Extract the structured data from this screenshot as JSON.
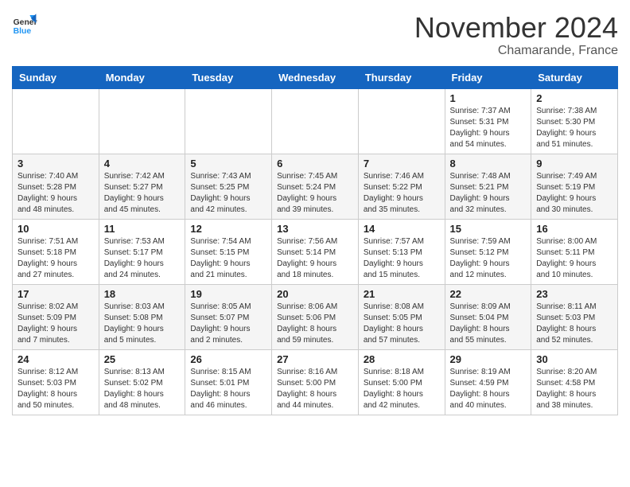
{
  "header": {
    "logo_line1": "General",
    "logo_line2": "Blue",
    "month": "November 2024",
    "location": "Chamarande, France"
  },
  "weekdays": [
    "Sunday",
    "Monday",
    "Tuesday",
    "Wednesday",
    "Thursday",
    "Friday",
    "Saturday"
  ],
  "weeks": [
    [
      {
        "day": "",
        "info": ""
      },
      {
        "day": "",
        "info": ""
      },
      {
        "day": "",
        "info": ""
      },
      {
        "day": "",
        "info": ""
      },
      {
        "day": "",
        "info": ""
      },
      {
        "day": "1",
        "info": "Sunrise: 7:37 AM\nSunset: 5:31 PM\nDaylight: 9 hours\nand 54 minutes."
      },
      {
        "day": "2",
        "info": "Sunrise: 7:38 AM\nSunset: 5:30 PM\nDaylight: 9 hours\nand 51 minutes."
      }
    ],
    [
      {
        "day": "3",
        "info": "Sunrise: 7:40 AM\nSunset: 5:28 PM\nDaylight: 9 hours\nand 48 minutes."
      },
      {
        "day": "4",
        "info": "Sunrise: 7:42 AM\nSunset: 5:27 PM\nDaylight: 9 hours\nand 45 minutes."
      },
      {
        "day": "5",
        "info": "Sunrise: 7:43 AM\nSunset: 5:25 PM\nDaylight: 9 hours\nand 42 minutes."
      },
      {
        "day": "6",
        "info": "Sunrise: 7:45 AM\nSunset: 5:24 PM\nDaylight: 9 hours\nand 39 minutes."
      },
      {
        "day": "7",
        "info": "Sunrise: 7:46 AM\nSunset: 5:22 PM\nDaylight: 9 hours\nand 35 minutes."
      },
      {
        "day": "8",
        "info": "Sunrise: 7:48 AM\nSunset: 5:21 PM\nDaylight: 9 hours\nand 32 minutes."
      },
      {
        "day": "9",
        "info": "Sunrise: 7:49 AM\nSunset: 5:19 PM\nDaylight: 9 hours\nand 30 minutes."
      }
    ],
    [
      {
        "day": "10",
        "info": "Sunrise: 7:51 AM\nSunset: 5:18 PM\nDaylight: 9 hours\nand 27 minutes."
      },
      {
        "day": "11",
        "info": "Sunrise: 7:53 AM\nSunset: 5:17 PM\nDaylight: 9 hours\nand 24 minutes."
      },
      {
        "day": "12",
        "info": "Sunrise: 7:54 AM\nSunset: 5:15 PM\nDaylight: 9 hours\nand 21 minutes."
      },
      {
        "day": "13",
        "info": "Sunrise: 7:56 AM\nSunset: 5:14 PM\nDaylight: 9 hours\nand 18 minutes."
      },
      {
        "day": "14",
        "info": "Sunrise: 7:57 AM\nSunset: 5:13 PM\nDaylight: 9 hours\nand 15 minutes."
      },
      {
        "day": "15",
        "info": "Sunrise: 7:59 AM\nSunset: 5:12 PM\nDaylight: 9 hours\nand 12 minutes."
      },
      {
        "day": "16",
        "info": "Sunrise: 8:00 AM\nSunset: 5:11 PM\nDaylight: 9 hours\nand 10 minutes."
      }
    ],
    [
      {
        "day": "17",
        "info": "Sunrise: 8:02 AM\nSunset: 5:09 PM\nDaylight: 9 hours\nand 7 minutes."
      },
      {
        "day": "18",
        "info": "Sunrise: 8:03 AM\nSunset: 5:08 PM\nDaylight: 9 hours\nand 5 minutes."
      },
      {
        "day": "19",
        "info": "Sunrise: 8:05 AM\nSunset: 5:07 PM\nDaylight: 9 hours\nand 2 minutes."
      },
      {
        "day": "20",
        "info": "Sunrise: 8:06 AM\nSunset: 5:06 PM\nDaylight: 8 hours\nand 59 minutes."
      },
      {
        "day": "21",
        "info": "Sunrise: 8:08 AM\nSunset: 5:05 PM\nDaylight: 8 hours\nand 57 minutes."
      },
      {
        "day": "22",
        "info": "Sunrise: 8:09 AM\nSunset: 5:04 PM\nDaylight: 8 hours\nand 55 minutes."
      },
      {
        "day": "23",
        "info": "Sunrise: 8:11 AM\nSunset: 5:03 PM\nDaylight: 8 hours\nand 52 minutes."
      }
    ],
    [
      {
        "day": "24",
        "info": "Sunrise: 8:12 AM\nSunset: 5:03 PM\nDaylight: 8 hours\nand 50 minutes."
      },
      {
        "day": "25",
        "info": "Sunrise: 8:13 AM\nSunset: 5:02 PM\nDaylight: 8 hours\nand 48 minutes."
      },
      {
        "day": "26",
        "info": "Sunrise: 8:15 AM\nSunset: 5:01 PM\nDaylight: 8 hours\nand 46 minutes."
      },
      {
        "day": "27",
        "info": "Sunrise: 8:16 AM\nSunset: 5:00 PM\nDaylight: 8 hours\nand 44 minutes."
      },
      {
        "day": "28",
        "info": "Sunrise: 8:18 AM\nSunset: 5:00 PM\nDaylight: 8 hours\nand 42 minutes."
      },
      {
        "day": "29",
        "info": "Sunrise: 8:19 AM\nSunset: 4:59 PM\nDaylight: 8 hours\nand 40 minutes."
      },
      {
        "day": "30",
        "info": "Sunrise: 8:20 AM\nSunset: 4:58 PM\nDaylight: 8 hours\nand 38 minutes."
      }
    ]
  ]
}
